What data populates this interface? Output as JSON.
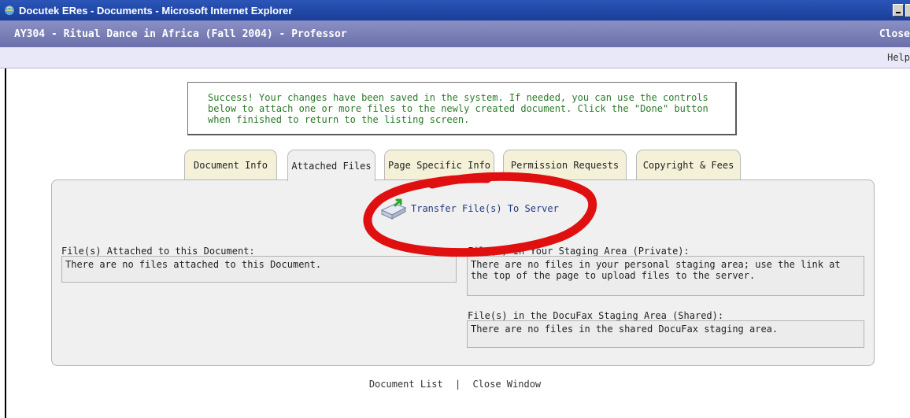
{
  "window": {
    "title": "Docutek ERes - Documents - Microsoft Internet Explorer"
  },
  "course": {
    "title": "AY304 - Ritual Dance in Africa (Fall 2004) - Professor",
    "close_label": "Close"
  },
  "help": {
    "label": "Help"
  },
  "message": {
    "text": "Success! Your changes have been saved in the system. If needed, you can use the controls below to attach one or more files to the newly created document. Click the \"Done\" button when finished to return to the listing screen.",
    "color": "#2a7a2a"
  },
  "tabs": [
    {
      "label": "Document Info",
      "active": false
    },
    {
      "label": "Attached Files",
      "active": true
    },
    {
      "label": "Page Specific Info",
      "active": false
    },
    {
      "label": "Permission Requests",
      "active": false
    },
    {
      "label": "Copyright & Fees",
      "active": false
    }
  ],
  "transfer": {
    "label": "Transfer File(s) To Server",
    "icon": "upload-drive-icon"
  },
  "attached": {
    "label": "File(s) Attached to this Document:",
    "empty_text": "There are no files attached to this Document."
  },
  "private_staging": {
    "label": "File(s) in Your Staging Area (Private):",
    "empty_text": "There are no files in your personal staging area; use the link at the top of the page to upload files to the server."
  },
  "shared_staging": {
    "label": "File(s) in the DocuFax Staging Area (Shared):",
    "empty_text": "There are no files in the shared DocuFax staging area."
  },
  "footer": {
    "document_list": "Document List",
    "separator": "|",
    "close_window": "Close Window"
  },
  "annotation": {
    "color": "#e01010"
  }
}
